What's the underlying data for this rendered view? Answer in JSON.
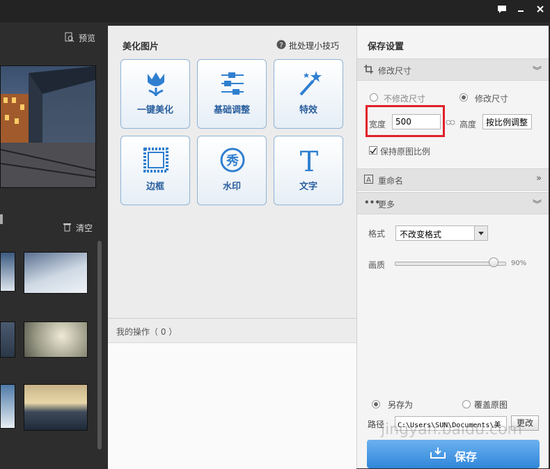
{
  "titlebar": {
    "icons": [
      "chat-icon",
      "minimize-icon",
      "close-icon"
    ]
  },
  "left": {
    "preview_label": "预览",
    "clear_label": "清空"
  },
  "middle": {
    "section_title": "美化图片",
    "tips_label": "批处理小技巧",
    "tools": [
      {
        "label": "一键美化",
        "icon": "tulip-icon"
      },
      {
        "label": "基础调整",
        "icon": "sliders-icon"
      },
      {
        "label": "特效",
        "icon": "magic-wand-icon"
      },
      {
        "label": "边框",
        "icon": "frame-icon"
      },
      {
        "label": "水印",
        "icon": "watermark-icon",
        "glyph": "秀"
      },
      {
        "label": "文字",
        "icon": "text-icon",
        "glyph": "T"
      }
    ],
    "operations_label": "我的操作（ 0 ）"
  },
  "right": {
    "title": "保存设置",
    "resize": {
      "header": "修改尺寸",
      "no_resize": "不修改尺寸",
      "resize": "修改尺寸",
      "width_label": "宽度",
      "width_value": "500",
      "height_label": "高度",
      "height_value": "按比例调整",
      "keep_ratio": "保持原图比例"
    },
    "rename": {
      "header": "重命名"
    },
    "more": {
      "header": "更多",
      "format_label": "格式",
      "format_value": "不改变格式",
      "quality_label": "画质",
      "quality_value": "90%",
      "quality_fraction": 0.9
    },
    "save_as": "另存为",
    "overwrite": "覆盖原图",
    "path_label": "路径",
    "path_value": "C:\\Users\\SUN\\Documents\\美",
    "change_label": "更改",
    "save_label": "保存"
  },
  "watermark_text": "jingyan.baidu.com",
  "colors": {
    "accent": "#2f86d9",
    "highlight": "#e0202a"
  }
}
